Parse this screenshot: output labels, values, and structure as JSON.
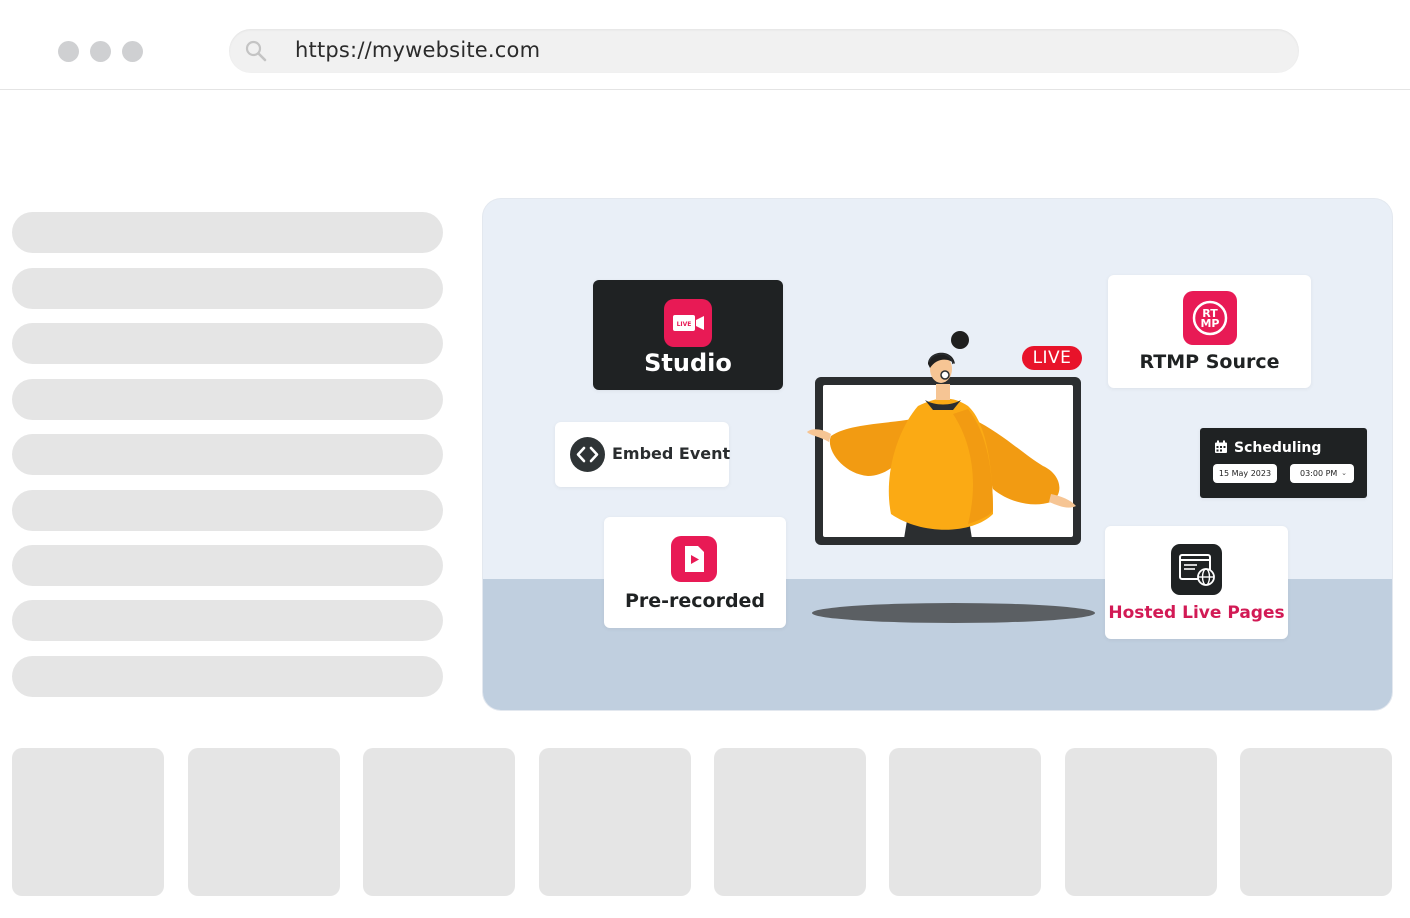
{
  "browser": {
    "window_dots": [
      "window-dot-1",
      "window-dot-2",
      "window-dot-3"
    ],
    "url": "https://mywebsite.com",
    "search_icon": "search-icon"
  },
  "hero": {
    "studio": {
      "label": "Studio",
      "icon": "live-camera-icon"
    },
    "rtmp": {
      "label": "RTMP Source",
      "icon_text": "RT MP",
      "icon": "rtmp-icon"
    },
    "embed": {
      "label": "Embed Event",
      "icon": "code-brackets-icon"
    },
    "prerecorded": {
      "label": "Pre-recorded",
      "icon": "video-file-icon"
    },
    "hosted": {
      "label": "Hosted Live Pages",
      "icon": "web-page-globe-icon"
    },
    "scheduling": {
      "label": "Scheduling",
      "icon": "calendar-icon",
      "date": "15 May 2023",
      "time": "03:00 PM"
    },
    "live_badge": "LIVE"
  },
  "colors": {
    "accent_pink": "#e81a55",
    "live_red": "#e8132a",
    "hosted_text": "#d21a55",
    "dark_card": "#1f2223",
    "hero_bg": "#e9eff7",
    "floor": "#c0cfdf",
    "skeleton": "#e5e5e5"
  }
}
